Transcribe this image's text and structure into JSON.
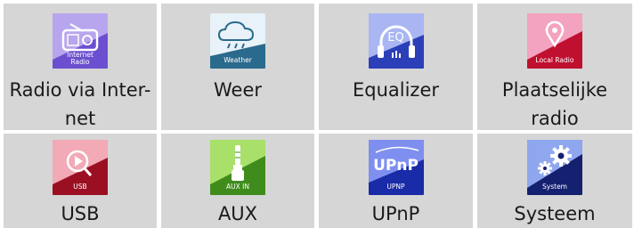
{
  "tiles": [
    {
      "id": "internet-radio",
      "label_line1": "Radio via Inter-",
      "label_line2": "net",
      "icon_caption_line1": "Internet",
      "icon_caption_line2": "Radio",
      "icon": "radio-icon",
      "colors": [
        "#b7a6ee",
        "#6b4fd0"
      ]
    },
    {
      "id": "weather",
      "label": "Weer",
      "icon_caption": "Weather",
      "icon": "cloud-rain-icon",
      "colors": [
        "#e8f2f8",
        "#2a6a8c"
      ]
    },
    {
      "id": "equalizer",
      "label": "Equalizer",
      "icon_caption": "EQ",
      "icon": "headphones-icon",
      "colors": [
        "#a9b6f2",
        "#2b3fb8"
      ]
    },
    {
      "id": "local-radio",
      "label": "Plaatselijke radio",
      "icon_caption": "Local Radio",
      "icon": "map-pin-icon",
      "colors": [
        "#f3a3bf",
        "#c01030"
      ]
    },
    {
      "id": "usb",
      "label": "USB",
      "icon_caption": "USB",
      "icon": "play-search-icon",
      "colors": [
        "#f1aab6",
        "#9a1022"
      ]
    },
    {
      "id": "aux",
      "label": "AUX",
      "icon_caption": "AUX IN",
      "icon": "audio-jack-icon",
      "colors": [
        "#a8e06a",
        "#3f8c1c"
      ]
    },
    {
      "id": "upnp",
      "label": "UPnP",
      "icon_caption": "UPNP",
      "icon_logo": "UPnP",
      "icon": "upnp-logo-icon",
      "colors": [
        "#7e8ff0",
        "#1a2ba8"
      ]
    },
    {
      "id": "system",
      "label": "Systeem",
      "icon_caption": "System",
      "icon": "gears-icon",
      "colors": [
        "#8fa7ee",
        "#142070"
      ]
    }
  ]
}
